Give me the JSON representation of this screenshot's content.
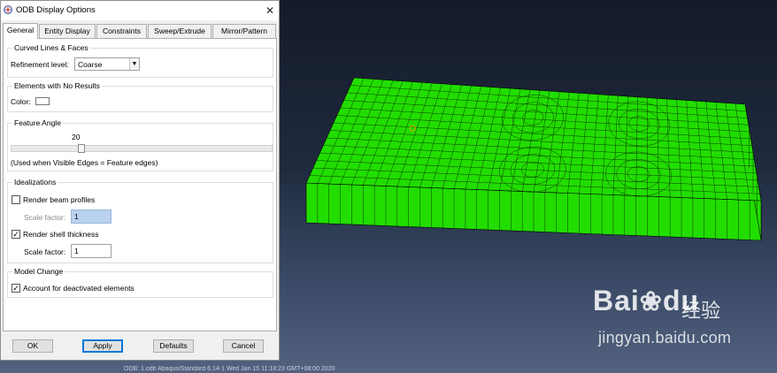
{
  "dialog": {
    "title": "ODB Display Options",
    "close_glyph": "✕",
    "tabs": [
      "General",
      "Entity Display",
      "Constraints",
      "Sweep/Extrude",
      "Mirror/Pattern"
    ],
    "active_tab": "General"
  },
  "curved": {
    "title": "Curved Lines & Faces",
    "refinement_label": "Refinement level:",
    "refinement_value": "Coarse"
  },
  "no_results": {
    "title": "Elements with No Results",
    "color_label": "Color:",
    "color_value": "#ffffff"
  },
  "feature_angle": {
    "title": "Feature Angle",
    "value": "20",
    "slider_fraction": 0.26,
    "note": "(Used when Visible Edges = Feature edges)"
  },
  "idealizations": {
    "title": "Idealizations",
    "beam_label": "Render beam profiles",
    "beam_checked": false,
    "beam_scale_label": "Scale factor:",
    "beam_scale_value": "1",
    "shell_label": "Render shell thickness",
    "shell_checked": true,
    "shell_scale_label": "Scale factor:",
    "shell_scale_value": "1"
  },
  "model_change": {
    "title": "Model Change",
    "deactivated_label": "Account for deactivated elements",
    "deactivated_checked": true
  },
  "buttons": {
    "ok": "OK",
    "apply": "Apply",
    "defaults": "Defaults",
    "cancel": "Cancel"
  },
  "viewport": {
    "mesh_color": "#22dd00",
    "status_text": "ODB: 1.odb    Abaqus/Standard 6.14-1    Wed Jan 15 11:18:23 GMT+08:00 2020"
  },
  "watermark": {
    "logo": "Bai",
    "logo_tail": "du",
    "brand": "经验",
    "url": "jingyan.baidu.com"
  }
}
